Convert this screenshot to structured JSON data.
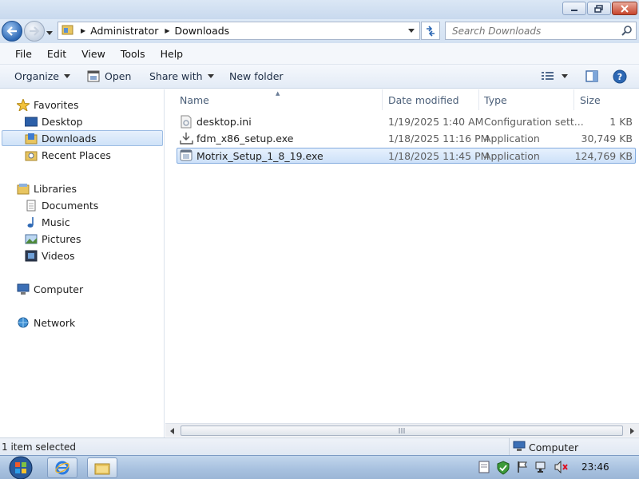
{
  "window": {
    "controls": {
      "minimize": "minimize-icon",
      "restore": "restore-icon",
      "close": "close-icon"
    }
  },
  "address": {
    "breadcrumbs": [
      "Administrator",
      "Downloads"
    ],
    "search_placeholder": "Search Downloads"
  },
  "menu": {
    "items": [
      {
        "label": "File"
      },
      {
        "label": "Edit"
      },
      {
        "label": "View"
      },
      {
        "label": "Tools"
      },
      {
        "label": "Help"
      }
    ]
  },
  "toolbar": {
    "organize": "Organize",
    "open": "Open",
    "share_with": "Share with",
    "new_folder": "New folder"
  },
  "nav": {
    "favorites": "Favorites",
    "desktop": "Desktop",
    "downloads": "Downloads",
    "recent_places": "Recent Places",
    "libraries": "Libraries",
    "documents": "Documents",
    "music": "Music",
    "pictures": "Pictures",
    "videos": "Videos",
    "computer": "Computer",
    "network": "Network"
  },
  "columns": {
    "name": "Name",
    "date_modified": "Date modified",
    "type": "Type",
    "size": "Size"
  },
  "files": [
    {
      "name": "desktop.ini",
      "date": "1/19/2025 1:40 AM",
      "type": "Configuration sett...",
      "size": "1 KB",
      "icon": "config-file-icon",
      "selected": false
    },
    {
      "name": "fdm_x86_setup.exe",
      "date": "1/18/2025 11:16 PM",
      "type": "Application",
      "size": "30,749 KB",
      "icon": "installer-icon",
      "selected": false
    },
    {
      "name": "Motrix_Setup_1_8_19.exe",
      "date": "1/18/2025 11:45 PM",
      "type": "Application",
      "size": "124,769 KB",
      "icon": "application-icon",
      "selected": true
    }
  ],
  "status": {
    "selection": "1 item selected",
    "location": "Computer"
  },
  "taskbar": {
    "clock": "23:46"
  },
  "colors": {
    "accent": "#2d68b4",
    "selection": "#cde1f9",
    "taskbar": "#a9c2e0"
  }
}
